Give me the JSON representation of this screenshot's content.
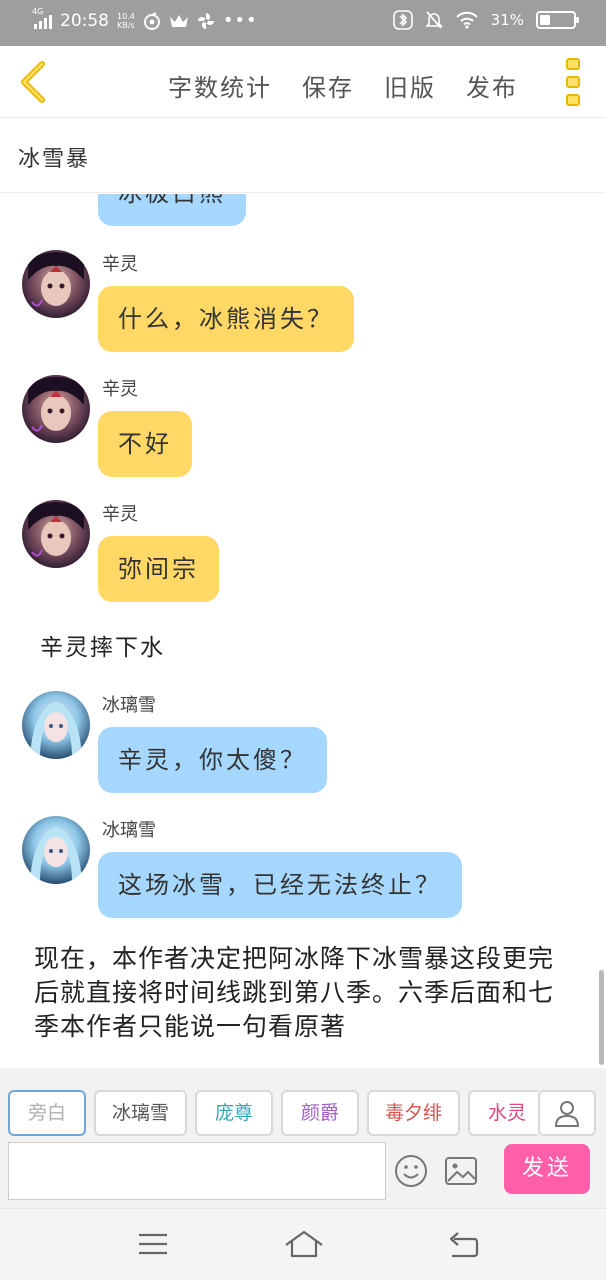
{
  "status_bar": {
    "network": "4G",
    "time": "20:58",
    "net_speed_value": "10.4",
    "net_speed_unit": "KB/s",
    "battery_text": "31%",
    "battery_level": 0.31
  },
  "toolbar": {
    "back_icon": "chevron-left-icon",
    "actions": [
      "字数统计",
      "保存",
      "旧版",
      "发布"
    ],
    "more_icon": "more-vertical-icon"
  },
  "title": "冰雪暴",
  "chat": {
    "partial_bubble": "冰极白熊",
    "messages": [
      {
        "type": "message",
        "speaker": "辛灵",
        "text": "什么，冰熊消失？",
        "bubble_color": "#ffd866"
      },
      {
        "type": "message",
        "speaker": "辛灵",
        "text": "不好",
        "bubble_color": "#ffd866"
      },
      {
        "type": "message",
        "speaker": "辛灵",
        "text": "弥间宗",
        "bubble_color": "#ffd866"
      },
      {
        "type": "narration",
        "text": "辛灵摔下水"
      },
      {
        "type": "message",
        "speaker": "冰璃雪",
        "text": "辛灵，你太傻？",
        "bubble_color": "#a6d8ff"
      },
      {
        "type": "message",
        "speaker": "冰璃雪",
        "text": "这场冰雪，已经无法终止？",
        "bubble_color": "#a6d8ff"
      }
    ],
    "narration_block": "现在，本作者决定把阿冰降下冰雪暴这段更完后就直接将时间线跳到第八季。六季后面和七季本作者只能说一句看原著"
  },
  "roles": [
    {
      "label": "旁白",
      "color": "#b0b0b0",
      "active": true
    },
    {
      "label": "冰璃雪",
      "color": "#555555",
      "active": false
    },
    {
      "label": "庞尊",
      "color": "#3aa8b8",
      "active": false
    },
    {
      "label": "颜爵",
      "color": "#a45ec8",
      "active": false
    },
    {
      "label": "毒夕绯",
      "color": "#d9534f",
      "active": false
    },
    {
      "label": "水灵",
      "color": "#e0457b",
      "active": false
    }
  ],
  "composer": {
    "input_value": "",
    "send_label": "发送",
    "send_color": "#ff5fa8"
  },
  "nav": {
    "icons": [
      "menu-icon",
      "home-icon",
      "back-arrow-icon"
    ]
  }
}
